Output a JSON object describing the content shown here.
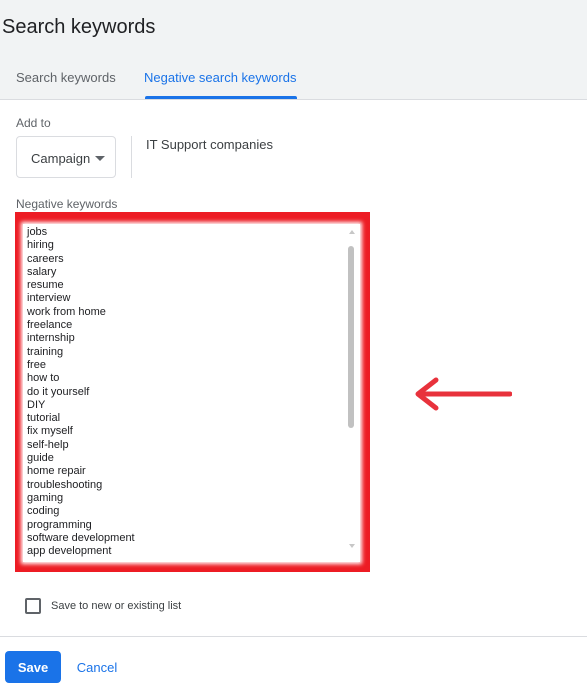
{
  "header": {
    "title": "Search keywords",
    "tabs": [
      {
        "label": "Search keywords",
        "active": false
      },
      {
        "label": "Negative search keywords",
        "active": true
      }
    ]
  },
  "form": {
    "add_to_label": "Add to",
    "level_value": "Campaign",
    "campaign_name": "IT Support companies",
    "negative_keywords_label": "Negative keywords",
    "keywords": [
      "jobs",
      "hiring",
      "careers",
      "salary",
      "resume",
      "interview",
      "work from home",
      "freelance",
      "internship",
      "training",
      "free",
      "how to",
      "do it yourself",
      "DIY",
      "tutorial",
      "fix myself",
      "self-help",
      "guide",
      "home repair",
      "troubleshooting",
      "gaming",
      "coding",
      "programming",
      "software development",
      "app development"
    ],
    "save_to_list_label": "Save to new or existing list",
    "save_to_list_checked": false
  },
  "footer": {
    "save_label": "Save",
    "cancel_label": "Cancel"
  },
  "colors": {
    "accent": "#1a73e8",
    "highlight_frame": "#ed1c24",
    "arrow": "#e8323c"
  }
}
